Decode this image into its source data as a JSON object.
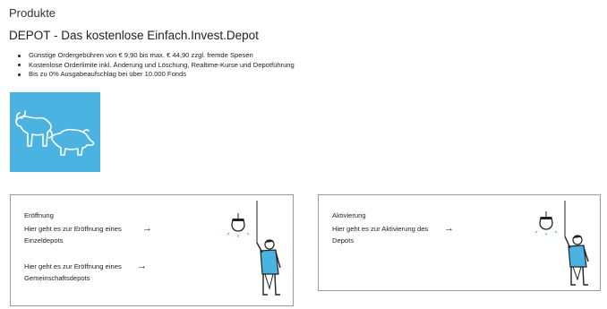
{
  "page": {
    "heading": "Produkte"
  },
  "product": {
    "title": "DEPOT - Das kostenlose Einfach.Invest.Depot",
    "benefits": [
      "Günstige Ordergebühren von € 9,90 bis max. € 44,90 zzgl. fremde Spesen",
      "Kostenlose Orderlimite inkl. Änderung und Löschung, Realtime-Kurse und Depotführung",
      "Bis zu 0% Ausgabeaufschlag bei über 10.000 Fonds"
    ],
    "tile_color": "#4bb3e2"
  },
  "cards": {
    "opening": {
      "title": "Eröffnung",
      "links": [
        {
          "line1": "Hier geht es zur Eröffnung eines",
          "line2": "Einzeldepots"
        },
        {
          "line1": "Hier geht es zur Eröffnung eines",
          "line2": "Gemeinschaftsdepots"
        }
      ]
    },
    "activation": {
      "title": "Aktivierung",
      "links": [
        {
          "line1": "Hier geht es zur Aktivierung des",
          "line2": "Depots"
        }
      ]
    }
  },
  "icons": {
    "arrow": "→",
    "tile": "bull-bear-icon",
    "figure": "person-pulling-light-cord-icon"
  }
}
